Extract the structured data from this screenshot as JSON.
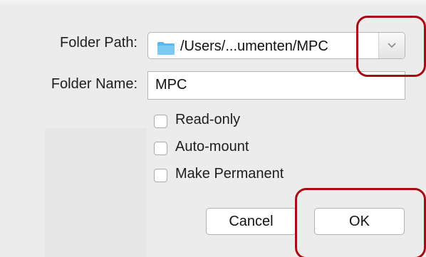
{
  "dialog": {
    "folder_path": {
      "label": "Folder Path:",
      "value": "/Users/...umenten/MPC",
      "folder_icon": "folder-icon",
      "dropdown_icon": "chevron-down-icon"
    },
    "folder_name": {
      "label": "Folder Name:",
      "value": "MPC"
    },
    "options": [
      {
        "label": "Read-only",
        "checked": false
      },
      {
        "label": "Auto-mount",
        "checked": false
      },
      {
        "label": "Make Permanent",
        "checked": false
      }
    ],
    "buttons": {
      "cancel_label": "Cancel",
      "ok_label": "OK"
    }
  },
  "colors": {
    "background": "#ececec",
    "folder_icon": "#5ab8ee",
    "highlight": "#a30d16"
  }
}
